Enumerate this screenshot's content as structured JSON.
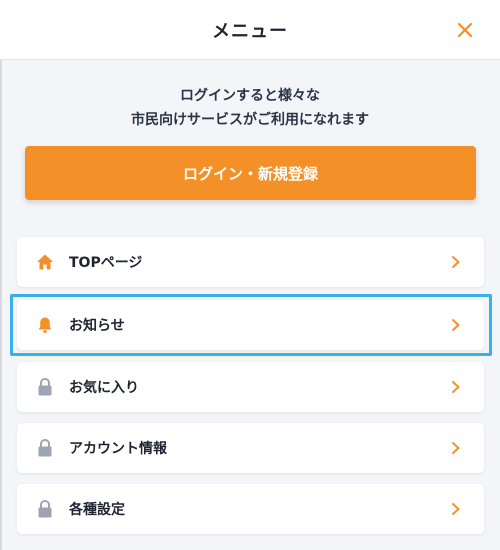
{
  "header": {
    "title": "メニュー",
    "close_icon": "close-icon"
  },
  "login_prompt": {
    "line1": "ログインすると様々な",
    "line2": "市民向けサービスがご利用になれます"
  },
  "login_button": {
    "label": "ログイン・新規登録"
  },
  "menu": {
    "items": [
      {
        "label": "TOPページ",
        "icon": "home-icon"
      },
      {
        "label": "お知らせ",
        "icon": "bell-icon"
      },
      {
        "label": "お気に入り",
        "icon": "lock-icon"
      },
      {
        "label": "アカウント情報",
        "icon": "lock-icon"
      },
      {
        "label": "各種設定",
        "icon": "lock-icon"
      }
    ]
  },
  "colors": {
    "accent": "#f39027",
    "highlight": "#3ab0ea",
    "locked": "#9ea4b2",
    "background": "#f4f5f8"
  }
}
